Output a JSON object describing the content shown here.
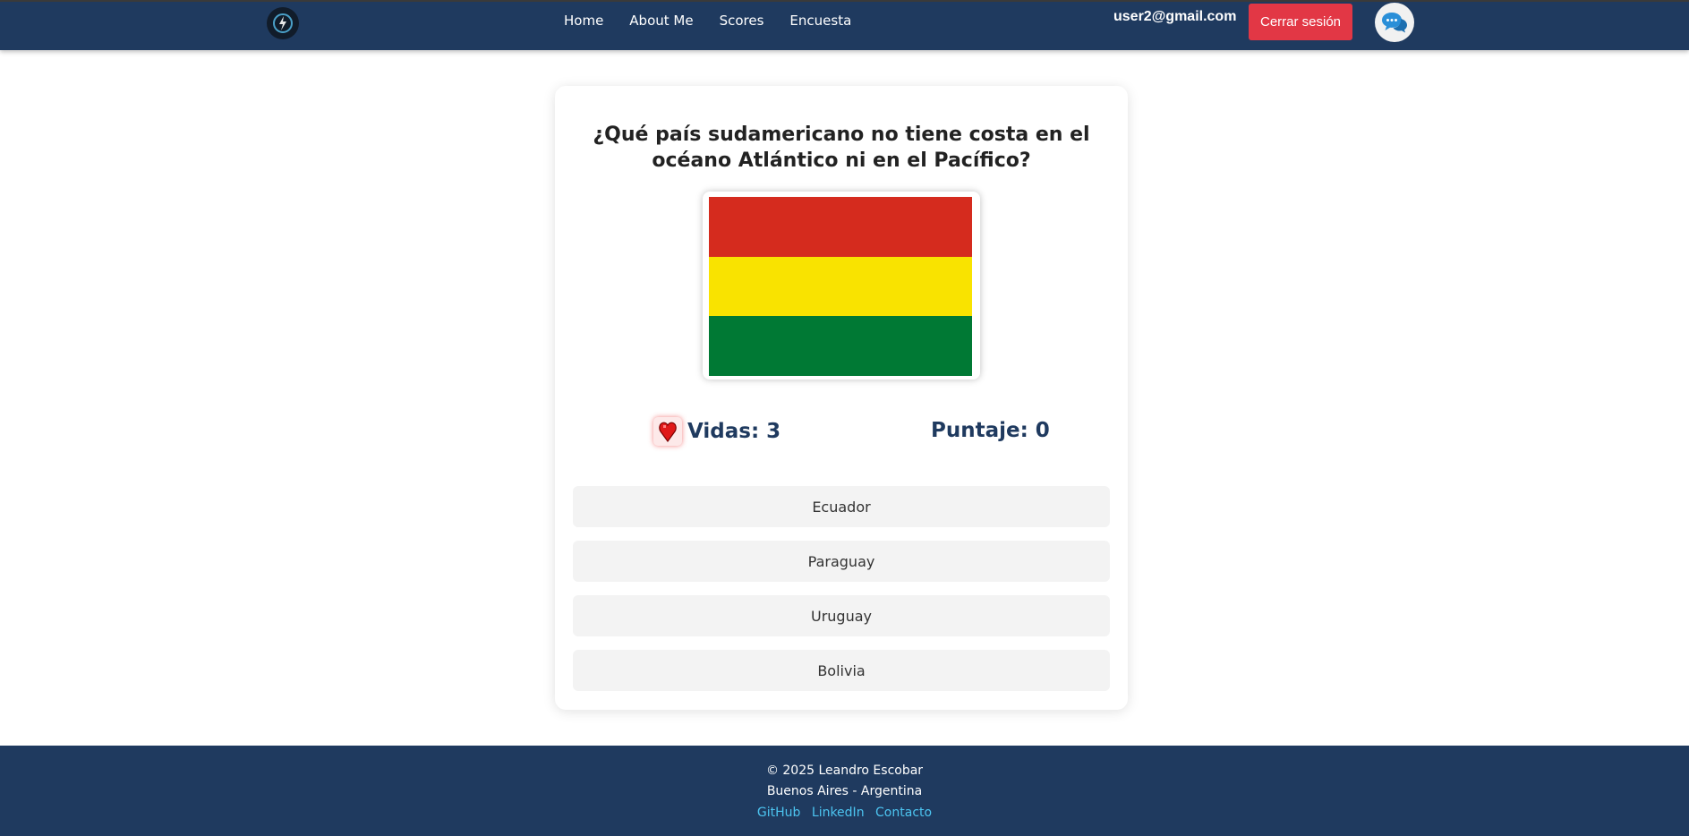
{
  "navbar": {
    "links": [
      "Home",
      "About Me",
      "Scores",
      "Encuesta"
    ],
    "user_email": "user2@gmail.com",
    "logout_label": "Cerrar sesión",
    "logo_icon": "bolt-logo-icon",
    "chat_icon": "chat-bubbles-icon"
  },
  "quiz": {
    "question": "¿Qué país sudamericano no tiene costa en el océano Atlántico ni en el Pacífico?",
    "flag_colors": [
      "#d52b1e",
      "#f9e300",
      "#007934"
    ],
    "lives_label": "Vidas: 3",
    "score_label": "Puntaje: 0",
    "lives_icon": "heart-icon",
    "options": [
      "Ecuador",
      "Paraguay",
      "Uruguay",
      "Bolivia"
    ]
  },
  "footer": {
    "copyright": "© 2025 Leandro Escobar",
    "location": "Buenos Aires - Argentina",
    "links": [
      "GitHub",
      "LinkedIn",
      "Contacto"
    ]
  },
  "colors": {
    "navbar": "#1f3a5f",
    "logout": "#e23745",
    "link": "#4cc4f0"
  }
}
